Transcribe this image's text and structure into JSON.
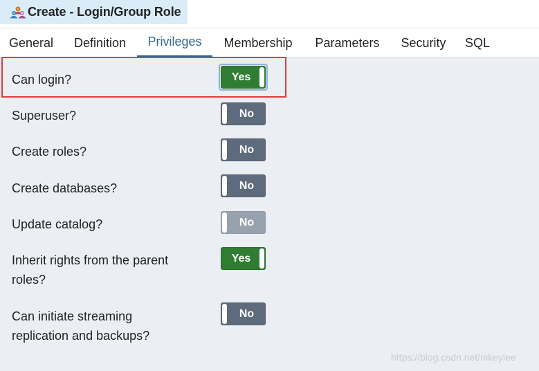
{
  "dialog": {
    "title": "Create - Login/Group Role",
    "icon": "group-role-icon"
  },
  "tabs": [
    {
      "label": "General",
      "active": false
    },
    {
      "label": "Definition",
      "active": false
    },
    {
      "label": "Privileges",
      "active": true
    },
    {
      "label": "Membership",
      "active": false
    },
    {
      "label": "Parameters",
      "active": false
    },
    {
      "label": "Security",
      "active": false
    },
    {
      "label": "SQL",
      "active": false
    }
  ],
  "privileges": [
    {
      "label": "Can login?",
      "value": "Yes",
      "state": "on",
      "highlighted": true
    },
    {
      "label": "Superuser?",
      "value": "No",
      "state": "off"
    },
    {
      "label": "Create roles?",
      "value": "No",
      "state": "off"
    },
    {
      "label": "Create databases?",
      "value": "No",
      "state": "off"
    },
    {
      "label": "Update catalog?",
      "value": "No",
      "state": "off",
      "disabled": true
    },
    {
      "label_line1": "Inherit rights from the parent",
      "label_line2": "roles?",
      "value": "Yes",
      "state": "on"
    },
    {
      "label_line1": "Can initiate streaming",
      "label_line2": "replication and backups?",
      "value": "No",
      "state": "off"
    }
  ],
  "colors": {
    "accent": "#326690",
    "toggle_on": "#2f7d32",
    "toggle_off": "#5e6b7d",
    "toggle_disabled": "#98a2ae",
    "highlight": "#e03b3b"
  },
  "watermark": "https://blog.csdn.net/nikeylee"
}
